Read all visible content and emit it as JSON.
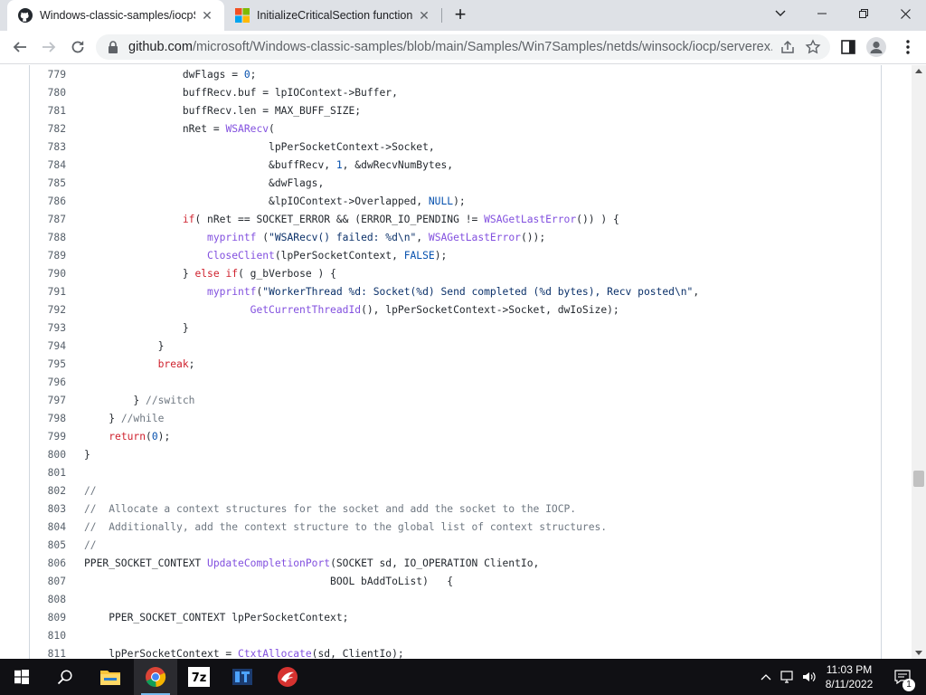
{
  "browser": {
    "tabs": [
      {
        "title": "Windows-classic-samples/iocpSe",
        "close": "✕"
      },
      {
        "title": "InitializeCriticalSection function (",
        "close": "✕"
      }
    ],
    "new_tab": "+",
    "url_host": "github.com",
    "url_path": "/microsoft/Windows-classic-samples/blob/main/Samples/Win7Samples/netds/winsock/iocp/serverex..."
  },
  "code": {
    "lines": [
      {
        "n": "779",
        "t": "                dwFlags = 0;"
      },
      {
        "n": "780",
        "t": "                buffRecv.buf = lpIOContext->Buffer,"
      },
      {
        "n": "781",
        "t": "                buffRecv.len = MAX_BUFF_SIZE;"
      },
      {
        "n": "782",
        "t": "                nRet = WSARecv("
      },
      {
        "n": "783",
        "t": "                              lpPerSocketContext->Socket,"
      },
      {
        "n": "784",
        "t": "                              &buffRecv, 1, &dwRecvNumBytes,"
      },
      {
        "n": "785",
        "t": "                              &dwFlags,"
      },
      {
        "n": "786",
        "t": "                              &lpIOContext->Overlapped, NULL);"
      },
      {
        "n": "787",
        "t": "                if( nRet == SOCKET_ERROR && (ERROR_IO_PENDING != WSAGetLastError()) ) {"
      },
      {
        "n": "788",
        "t": "                    myprintf (\"WSARecv() failed: %d\\n\", WSAGetLastError());"
      },
      {
        "n": "789",
        "t": "                    CloseClient(lpPerSocketContext, FALSE);"
      },
      {
        "n": "790",
        "t": "                } else if( g_bVerbose ) {"
      },
      {
        "n": "791",
        "t": "                    myprintf(\"WorkerThread %d: Socket(%d) Send completed (%d bytes), Recv posted\\n\","
      },
      {
        "n": "792",
        "t": "                           GetCurrentThreadId(), lpPerSocketContext->Socket, dwIoSize);"
      },
      {
        "n": "793",
        "t": "                }"
      },
      {
        "n": "794",
        "t": "            }"
      },
      {
        "n": "795",
        "t": "            break;"
      },
      {
        "n": "796",
        "t": ""
      },
      {
        "n": "797",
        "t": "        } //switch"
      },
      {
        "n": "798",
        "t": "    } //while"
      },
      {
        "n": "799",
        "t": "    return(0);"
      },
      {
        "n": "800",
        "t": "}"
      },
      {
        "n": "801",
        "t": ""
      },
      {
        "n": "802",
        "t": "//"
      },
      {
        "n": "803",
        "t": "//  Allocate a context structures for the socket and add the socket to the IOCP."
      },
      {
        "n": "804",
        "t": "//  Additionally, add the context structure to the global list of context structures."
      },
      {
        "n": "805",
        "t": "//"
      },
      {
        "n": "806",
        "t": "PPER_SOCKET_CONTEXT UpdateCompletionPort(SOCKET sd, IO_OPERATION ClientIo,"
      },
      {
        "n": "807",
        "t": "                                        BOOL bAddToList)   {"
      },
      {
        "n": "808",
        "t": ""
      },
      {
        "n": "809",
        "t": "    PPER_SOCKET_CONTEXT lpPerSocketContext;"
      },
      {
        "n": "810",
        "t": ""
      },
      {
        "n": "811",
        "t": "    lpPerSocketContext = CtxtAllocate(sd, ClientIo);"
      }
    ]
  },
  "taskbar": {
    "time": "11:03 PM",
    "date": "8/11/2022",
    "notification_count": "1",
    "apps": [
      "start-icon",
      "search-icon",
      "file-explorer-icon",
      "chrome-icon",
      "7zip-icon",
      "ida-icon",
      "app-icon"
    ]
  },
  "colors": {
    "keyword": "#cf222e",
    "function": "#8250df",
    "constant": "#0550ae",
    "comment": "#6e7781",
    "string": "#0a3069"
  }
}
